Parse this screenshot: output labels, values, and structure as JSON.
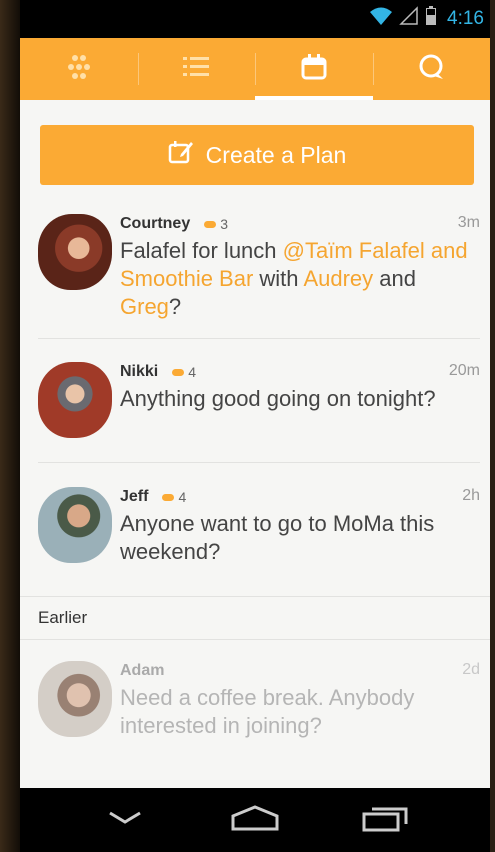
{
  "status": {
    "time": "4:16"
  },
  "tabs": [
    {
      "icon": "grid-dots-icon"
    },
    {
      "icon": "list-icon"
    },
    {
      "icon": "calendar-icon",
      "active": true
    },
    {
      "icon": "chat-bubble-icon"
    }
  ],
  "create_plan": {
    "label": "Create a Plan",
    "icon": "calendar-edit-icon"
  },
  "plans": [
    {
      "name": "Courtney",
      "comments": "3",
      "time": "3m",
      "text_parts": [
        {
          "t": "Falafel for lunch "
        },
        {
          "t": "@Taïm Falafel and Smoothie Bar",
          "hl": true
        },
        {
          "t": " with "
        },
        {
          "t": "Audrey",
          "hl": true
        },
        {
          "t": " and "
        },
        {
          "t": "Greg",
          "hl": true
        },
        {
          "t": "?"
        }
      ]
    },
    {
      "name": "Nikki",
      "comments": "4",
      "time": "20m",
      "text": "Anything good going on tonight?"
    },
    {
      "name": "Jeff",
      "comments": "4",
      "time": "2h",
      "text": "Anyone want to go to MoMa this weekend?"
    }
  ],
  "section_earlier": {
    "label": "Earlier"
  },
  "earlier_plans": [
    {
      "name": "Adam",
      "time": "2d",
      "text": "Need a coffee break. Anybody interested in joining?"
    }
  ],
  "colors": {
    "accent": "#fbaa34",
    "highlight": "#f5a530"
  }
}
